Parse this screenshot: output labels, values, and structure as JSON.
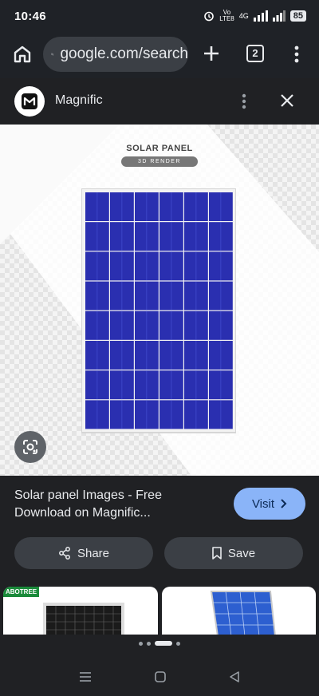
{
  "status": {
    "time": "10:46",
    "network_top": "Vo",
    "network_bottom": "LTE8",
    "signal_label": "4G",
    "battery": "85"
  },
  "browser": {
    "url": "google.com/search",
    "tab_count": "2"
  },
  "sheet": {
    "site_name": "Magnific",
    "image_caption": "SOLAR PANEL",
    "image_subcaption": "3D RENDER",
    "result_title": "Solar panel Images - Free Download on Magnific...",
    "visit_label": "Visit",
    "share_label": "Share",
    "save_label": "Save",
    "thumb1_tag": "ABOTREE"
  },
  "carousel": {
    "count": 4,
    "active_index": 2
  },
  "colors": {
    "background": "#1f2227",
    "visit_button": "#8ab4f8",
    "panel_cell": "#2a2fb0",
    "chip": "#3b3f45"
  },
  "icons": [
    "home-icon",
    "tune-icon",
    "plus-icon",
    "tabs-icon",
    "more-vert-icon",
    "magnific-logo-icon",
    "close-icon",
    "google-lens-icon",
    "chevron-right-icon",
    "share-icon",
    "bookmark-icon",
    "recents-icon",
    "home-square-icon",
    "back-icon"
  ]
}
